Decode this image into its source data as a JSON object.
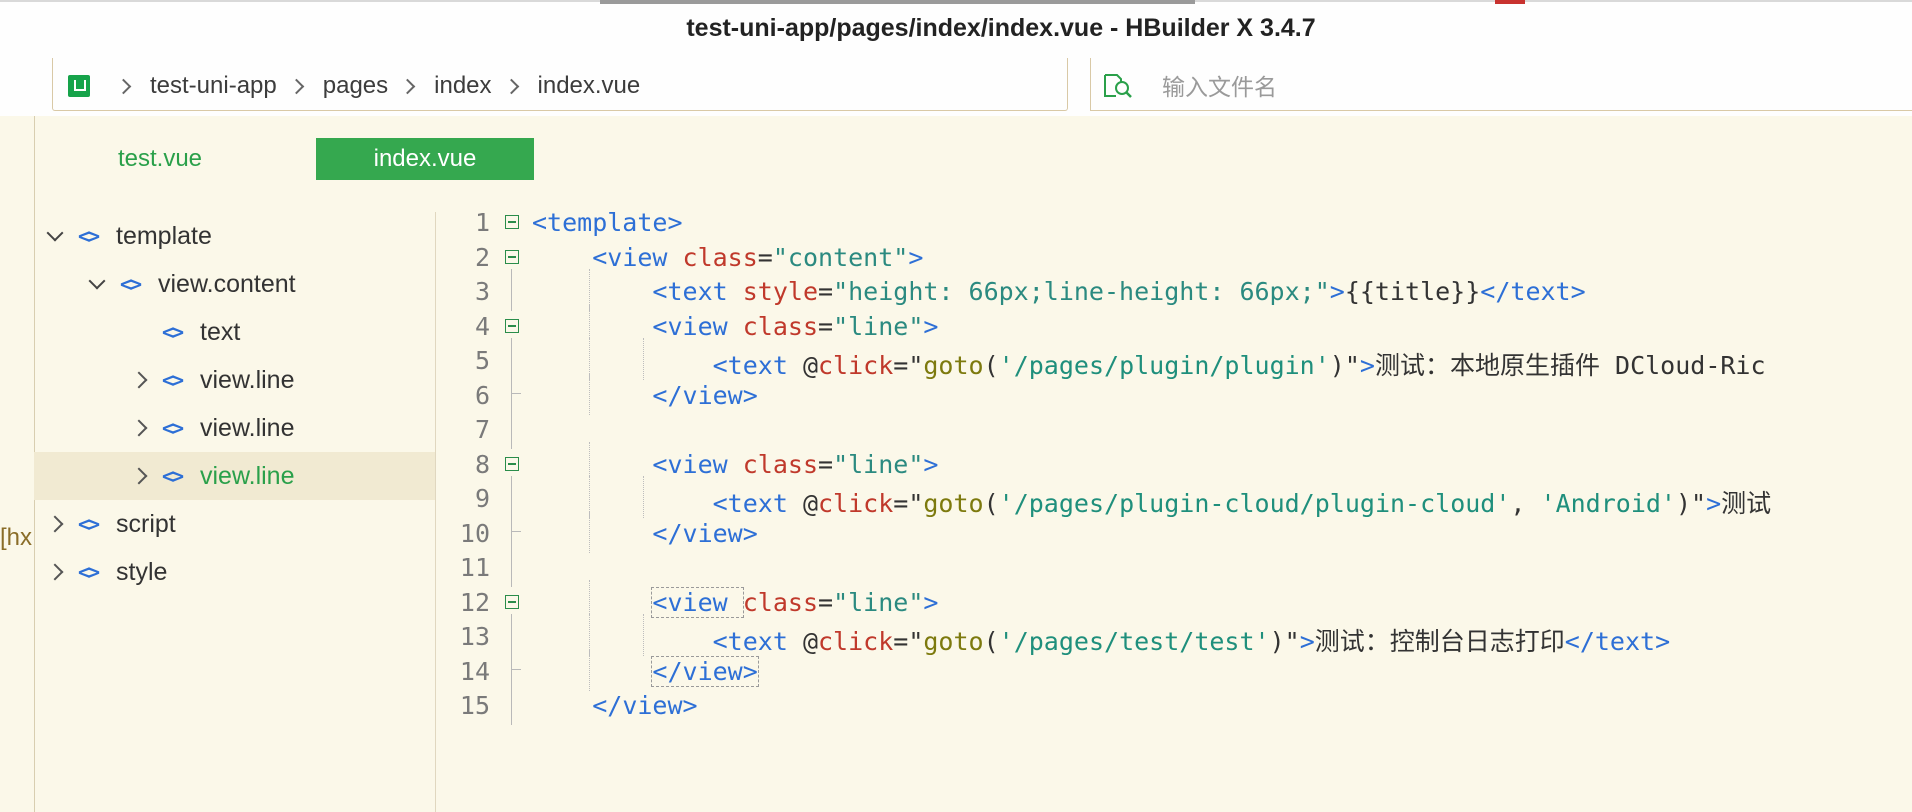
{
  "window": {
    "title": "test-uni-app/pages/index/index.vue - HBuilder X 3.4.7"
  },
  "breadcrumb": {
    "items": [
      "test-uni-app",
      "pages",
      "index",
      "index.vue"
    ]
  },
  "search": {
    "placeholder": "输入文件名",
    "value": ""
  },
  "gutter": {
    "text": "[hx"
  },
  "tabs": [
    {
      "label": "test.vue",
      "active": false
    },
    {
      "label": "index.vue",
      "active": true
    }
  ],
  "outline": [
    {
      "label": "template",
      "level": 0,
      "expanded": true,
      "selected": false
    },
    {
      "label": "view.content",
      "level": 1,
      "expanded": true,
      "selected": false
    },
    {
      "label": "text",
      "level": 2,
      "expanded": null,
      "selected": false
    },
    {
      "label": "view.line",
      "level": 2,
      "expanded": false,
      "selected": false
    },
    {
      "label": "view.line",
      "level": 2,
      "expanded": false,
      "selected": false
    },
    {
      "label": "view.line",
      "level": 2,
      "expanded": false,
      "selected": true
    },
    {
      "label": "script",
      "level": 0,
      "expanded": false,
      "selected": false
    },
    {
      "label": "style",
      "level": 0,
      "expanded": false,
      "selected": false
    }
  ],
  "code": {
    "line_numbers": [
      "1",
      "2",
      "3",
      "4",
      "5",
      "6",
      "7",
      "8",
      "9",
      "10",
      "11",
      "12",
      "13",
      "14",
      "15"
    ],
    "lines": [
      [
        {
          "c": "t",
          "s": "<template>"
        }
      ],
      [
        {
          "c": "p",
          "s": "    "
        },
        {
          "c": "t",
          "s": "<view "
        },
        {
          "c": "a",
          "s": "class"
        },
        {
          "c": "p",
          "s": "="
        },
        {
          "c": "v",
          "s": "\"content\""
        },
        {
          "c": "t",
          "s": ">"
        }
      ],
      [
        {
          "c": "p",
          "s": "        "
        },
        {
          "c": "t",
          "s": "<text "
        },
        {
          "c": "a",
          "s": "style"
        },
        {
          "c": "p",
          "s": "="
        },
        {
          "c": "v",
          "s": "\"height: 66px;line-height: 66px;\""
        },
        {
          "c": "t",
          "s": ">"
        },
        {
          "c": "p",
          "s": "{{title}}"
        },
        {
          "c": "t",
          "s": "</text>"
        }
      ],
      [
        {
          "c": "p",
          "s": "        "
        },
        {
          "c": "t",
          "s": "<view "
        },
        {
          "c": "a",
          "s": "class"
        },
        {
          "c": "p",
          "s": "="
        },
        {
          "c": "v",
          "s": "\"line\""
        },
        {
          "c": "t",
          "s": ">"
        }
      ],
      [
        {
          "c": "p",
          "s": "            "
        },
        {
          "c": "t",
          "s": "<text "
        },
        {
          "c": "p",
          "s": "@"
        },
        {
          "c": "a",
          "s": "click"
        },
        {
          "c": "p",
          "s": "=\""
        },
        {
          "c": "f",
          "s": "goto"
        },
        {
          "c": "p",
          "s": "("
        },
        {
          "c": "s",
          "s": "'/pages/plugin/plugin'"
        },
        {
          "c": "p",
          "s": ")\""
        },
        {
          "c": "t",
          "s": ">"
        },
        {
          "c": "p",
          "s": "测试：本地原生插件 DCloud-Ric"
        }
      ],
      [
        {
          "c": "p",
          "s": "        "
        },
        {
          "c": "t",
          "s": "</view>"
        }
      ],
      [],
      [
        {
          "c": "p",
          "s": "        "
        },
        {
          "c": "t",
          "s": "<view "
        },
        {
          "c": "a",
          "s": "class"
        },
        {
          "c": "p",
          "s": "="
        },
        {
          "c": "v",
          "s": "\"line\""
        },
        {
          "c": "t",
          "s": ">"
        }
      ],
      [
        {
          "c": "p",
          "s": "            "
        },
        {
          "c": "t",
          "s": "<text "
        },
        {
          "c": "p",
          "s": "@"
        },
        {
          "c": "a",
          "s": "click"
        },
        {
          "c": "p",
          "s": "=\""
        },
        {
          "c": "f",
          "s": "goto"
        },
        {
          "c": "p",
          "s": "("
        },
        {
          "c": "s",
          "s": "'/pages/plugin-cloud/plugin-cloud'"
        },
        {
          "c": "p",
          "s": ", "
        },
        {
          "c": "s",
          "s": "'Android'"
        },
        {
          "c": "p",
          "s": ")\""
        },
        {
          "c": "t",
          "s": ">"
        },
        {
          "c": "p",
          "s": "测试"
        }
      ],
      [
        {
          "c": "p",
          "s": "        "
        },
        {
          "c": "t",
          "s": "</view>"
        }
      ],
      [],
      [
        {
          "c": "p",
          "s": "        "
        },
        {
          "c": "t",
          "s": "<view "
        },
        {
          "c": "a",
          "s": "class"
        },
        {
          "c": "p",
          "s": "="
        },
        {
          "c": "v",
          "s": "\"line\""
        },
        {
          "c": "t",
          "s": ">"
        }
      ],
      [
        {
          "c": "p",
          "s": "            "
        },
        {
          "c": "t",
          "s": "<text "
        },
        {
          "c": "p",
          "s": "@"
        },
        {
          "c": "a",
          "s": "click"
        },
        {
          "c": "p",
          "s": "=\""
        },
        {
          "c": "f",
          "s": "goto"
        },
        {
          "c": "p",
          "s": "("
        },
        {
          "c": "s",
          "s": "'/pages/test/test'"
        },
        {
          "c": "p",
          "s": ")\""
        },
        {
          "c": "t",
          "s": ">"
        },
        {
          "c": "p",
          "s": "测试：控制台日志打印"
        },
        {
          "c": "t",
          "s": "</text>"
        }
      ],
      [
        {
          "c": "p",
          "s": "        "
        },
        {
          "c": "t",
          "s": "</view>"
        }
      ],
      [
        {
          "c": "p",
          "s": "    "
        },
        {
          "c": "t",
          "s": "</view>"
        }
      ]
    ]
  },
  "colors": {
    "accent": "#35a84f",
    "tag": "#2d6fd6",
    "attr": "#c0392b",
    "string": "#2b8a80",
    "background": "#fbf8e9"
  }
}
